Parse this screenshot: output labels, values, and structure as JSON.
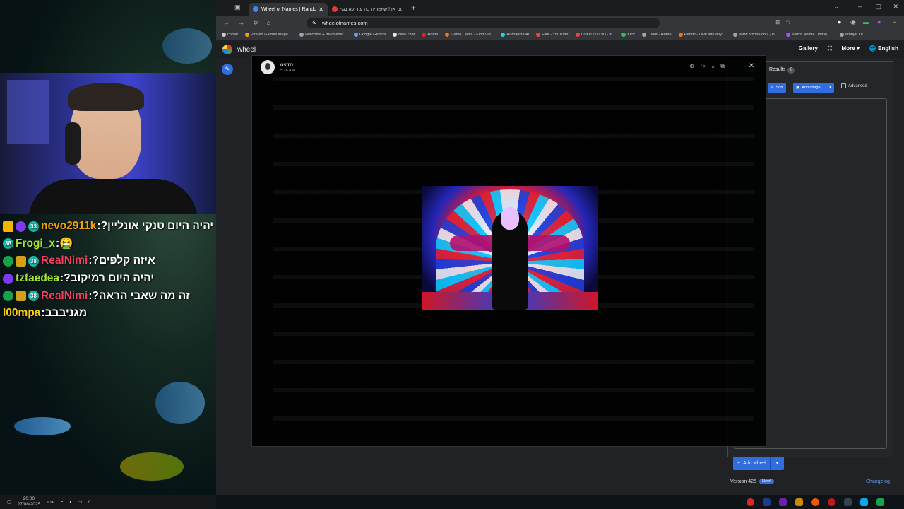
{
  "browser": {
    "tabs": [
      {
        "title": "Wheel of Names | Random nam",
        "active": true,
        "favicon_color": "#4285f4"
      },
      {
        "title": "הלקאד! שיפוריה כה עוד לא מגי",
        "active": false,
        "favicon_color": "#e53935"
      }
    ],
    "new_tab": "+",
    "url": "wheelofnames.com",
    "bookmarks": [
      {
        "label": "cobalt",
        "color": "#cccccc"
      },
      {
        "label": "Pirated Games Mega ...",
        "color": "#f59e0b"
      },
      {
        "label": "Welcome ▸ freemedia...",
        "color": "#9ca3af"
      },
      {
        "label": "Google Gemini",
        "color": "#60a5fa"
      },
      {
        "label": "New chat",
        "color": "#e5e7eb"
      },
      {
        "label": "Home",
        "color": "#dc2626"
      },
      {
        "label": "Game Deals - Find Vid...",
        "color": "#f97316"
      },
      {
        "label": "Humanize AI",
        "color": "#22d3ee"
      },
      {
        "label": "Flint - YouTube",
        "color": "#ef4444"
      },
      {
        "label": "סוכנויות כשרות - Y...",
        "color": "#ef4444"
      },
      {
        "label": "Kick",
        "color": "#22c55e"
      },
      {
        "label": "Lurkit - Home",
        "color": "#a3a3a3"
      },
      {
        "label": "Reddit - Dive into anyt...",
        "color": "#f97316"
      },
      {
        "label": "www.htzone.co.il - ים...",
        "color": "#a3a3a3"
      },
      {
        "label": "Watch Anime Online, ...",
        "color": "#a855f7"
      },
      {
        "label": "embyILTV",
        "color": "#a3a3a3"
      }
    ]
  },
  "won": {
    "title": "wheel",
    "nav": {
      "gallery": "Gallery",
      "more": "More",
      "language": "English"
    },
    "results_label": "Results",
    "results_count": "0",
    "sort_label": "Sort",
    "add_image_label": "Add image",
    "advanced_label": "Advanced",
    "add_wheel_label": "Add wheel",
    "version": "Version 425",
    "new_badge": "New!",
    "changelog": "Changelog"
  },
  "viewer": {
    "username": "ostro",
    "time": "5:26 AM"
  },
  "chat": [
    {
      "user": "nevo2911k",
      "color": "#f59e0b",
      "badges": [
        "crown",
        "purple",
        "teal"
      ],
      "badge_text": [
        "",
        "",
        "33"
      ],
      "message": "יהיה היום טנקי אונליין?"
    },
    {
      "user": "Frogi_x",
      "color": "#a3e635",
      "badges": [
        "teal"
      ],
      "badge_text": [
        "38"
      ],
      "message": "🤮"
    },
    {
      "user": "RealNimi",
      "color": "#f43f5e",
      "badges": [
        "green",
        "gold",
        "teal"
      ],
      "badge_text": [
        "",
        "",
        "38"
      ],
      "message": "איזה קלפים?"
    },
    {
      "user": "tzfaedea",
      "color": "#a3e635",
      "badges": [
        "purple"
      ],
      "badge_text": [
        ""
      ],
      "message": "יהיה היום רמיקוב?"
    },
    {
      "user": "RealNimi",
      "color": "#f43f5e",
      "badges": [
        "green",
        "gold",
        "teal"
      ],
      "badge_text": [
        "",
        "",
        "38"
      ],
      "message": "זה מה שאבי הראה?"
    },
    {
      "user": "l00mpa",
      "color": "#facc15",
      "badges": [],
      "badge_text": [],
      "message": "מגניבבב"
    }
  ],
  "tray": {
    "time": "20:00",
    "date": "27/08/2025",
    "lang": "עבר"
  }
}
